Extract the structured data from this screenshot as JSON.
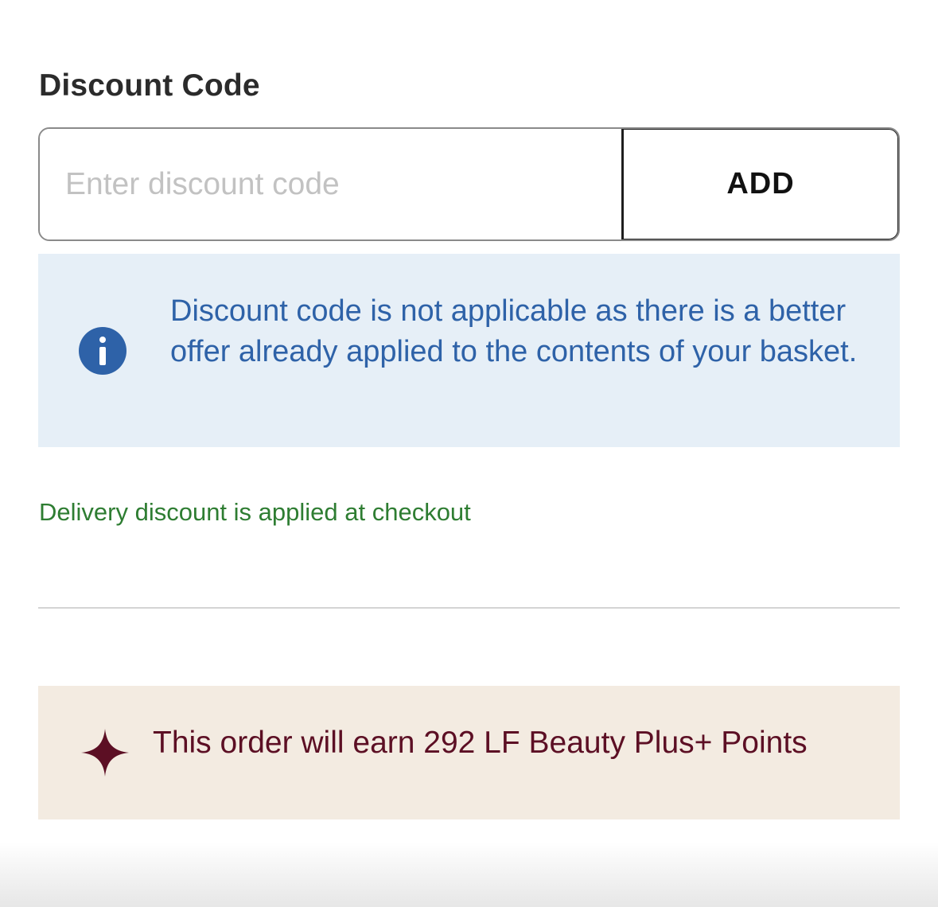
{
  "discount": {
    "title": "Discount Code",
    "input_placeholder": "Enter discount code",
    "input_value": "",
    "add_label": "ADD"
  },
  "info_message": {
    "icon": "info-icon",
    "text": "Discount code is not applicable as there is a better offer already applied to the contents of your basket."
  },
  "delivery_note": "Delivery discount is applied at checkout",
  "points_banner": {
    "icon": "sparkle-icon",
    "text": "This order will earn 292 LF Beauty Plus+ Points"
  },
  "colors": {
    "info_blue": "#2e62a8",
    "info_bg": "#e6eff7",
    "success_green": "#2e7d32",
    "points_maroon": "#5c0f24",
    "points_bg": "#f3ebe1"
  }
}
